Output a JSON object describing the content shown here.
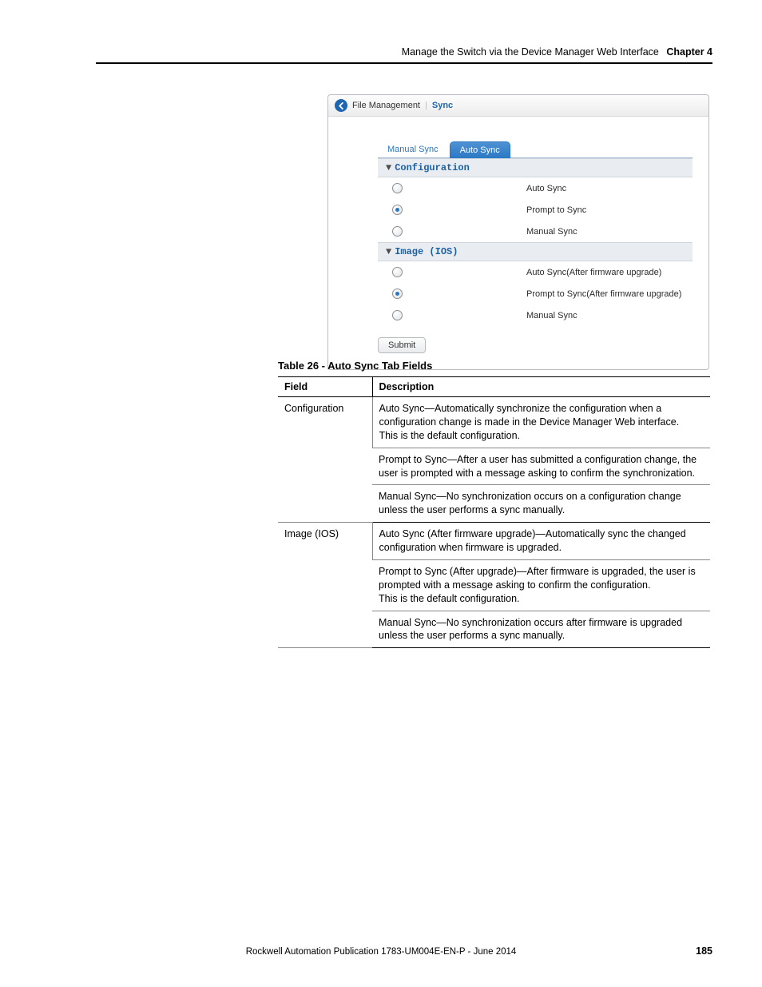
{
  "header": {
    "running_title": "Manage the Switch via the Device Manager Web Interface",
    "chapter_label": "Chapter 4"
  },
  "screenshot": {
    "breadcrumb1": "File Management",
    "separator": "|",
    "breadcrumb2": "Sync",
    "tabs": {
      "inactive": "Manual Sync",
      "active": "Auto Sync"
    },
    "section_config": {
      "title": "Configuration",
      "options": [
        {
          "label": "Auto Sync",
          "selected": false
        },
        {
          "label": "Prompt to Sync",
          "selected": true
        },
        {
          "label": "Manual Sync",
          "selected": false
        }
      ]
    },
    "section_image": {
      "title": "Image (IOS)",
      "options": [
        {
          "label": "Auto Sync(After firmware upgrade)",
          "selected": false
        },
        {
          "label": "Prompt to Sync(After firmware upgrade)",
          "selected": true
        },
        {
          "label": "Manual Sync",
          "selected": false
        }
      ]
    },
    "submit_label": "Submit"
  },
  "table": {
    "caption": "Table 26 - Auto Sync Tab Fields",
    "head_field": "Field",
    "head_desc": "Description",
    "rows": [
      {
        "field": "Configuration",
        "desc": "Auto Sync—Automatically synchronize the configuration when a configuration change is made in the Device Manager Web interface.\nThis is the default configuration."
      },
      {
        "field": "",
        "desc": "Prompt to Sync—After a user has submitted a configuration change, the user is prompted with a message asking to confirm the synchronization."
      },
      {
        "field": "",
        "desc": "Manual Sync—No synchronization occurs on a configuration change unless the user performs a sync manually."
      },
      {
        "field": "Image (IOS)",
        "desc": "Auto Sync (After firmware upgrade)—Automatically sync the changed configuration when firmware is upgraded."
      },
      {
        "field": "",
        "desc": "Prompt to Sync (After upgrade)—After firmware is upgraded, the user is prompted with a message asking to confirm the configuration.\nThis is the default configuration."
      },
      {
        "field": "",
        "desc": "Manual Sync—No synchronization occurs after firmware is upgraded unless the user performs a sync manually."
      }
    ]
  },
  "footer": {
    "pub": "Rockwell Automation Publication 1783-UM004E-EN-P - June 2014",
    "page": "185"
  }
}
